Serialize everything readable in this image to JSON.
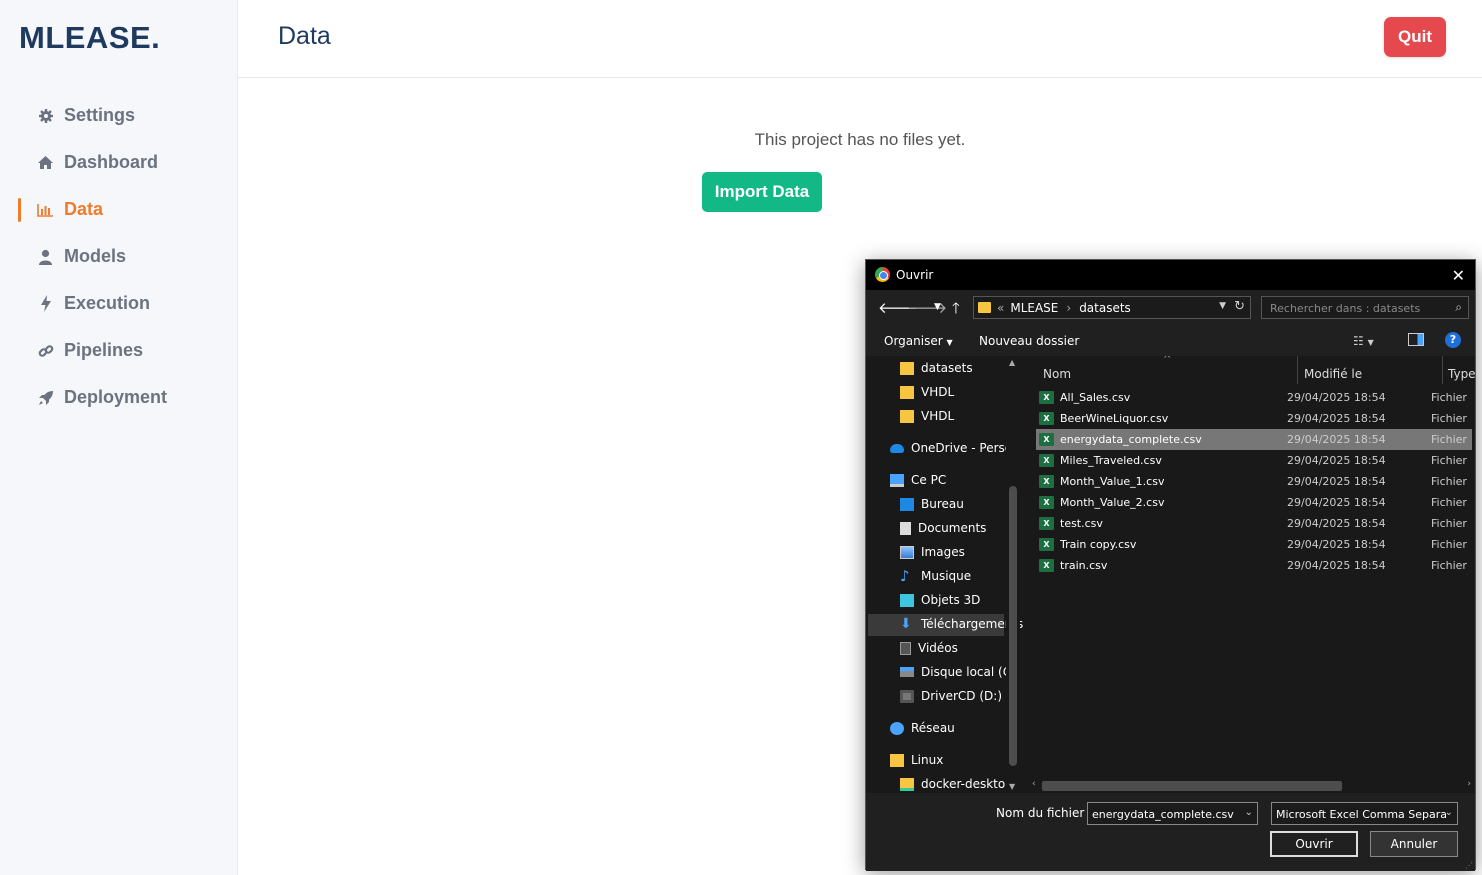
{
  "app": {
    "logo": "MLEASE."
  },
  "sidebar": {
    "items": [
      {
        "label": "Settings",
        "icon": "gear-icon"
      },
      {
        "label": "Dashboard",
        "icon": "home-icon"
      },
      {
        "label": "Data",
        "icon": "bar-chart-icon",
        "active": true
      },
      {
        "label": "Models",
        "icon": "user-icon"
      },
      {
        "label": "Execution",
        "icon": "bolt-icon"
      },
      {
        "label": "Pipelines",
        "icon": "link-icon"
      },
      {
        "label": "Deployment",
        "icon": "rocket-icon"
      }
    ]
  },
  "header": {
    "title": "Data",
    "quit_label": "Quit"
  },
  "main": {
    "empty_text": "This project has no files yet.",
    "import_label": "Import Data"
  },
  "dialog": {
    "title": "Ouvrir",
    "path": {
      "prefix": "«",
      "segments": [
        "MLEASE",
        "datasets"
      ]
    },
    "search_placeholder": "Rechercher dans : datasets",
    "toolbar": {
      "organize": "Organiser",
      "new_folder": "Nouveau dossier",
      "help": "?"
    },
    "tree": [
      {
        "label": "datasets",
        "icon": "folder-icon"
      },
      {
        "label": "VHDL",
        "icon": "folder-icon"
      },
      {
        "label": "VHDL",
        "icon": "folder-icon"
      },
      {
        "label": "OneDrive - Persor",
        "icon": "cloud-icon"
      },
      {
        "label": "Ce PC",
        "icon": "computer-icon"
      },
      {
        "label": "Bureau",
        "icon": "desktop-icon"
      },
      {
        "label": "Documents",
        "icon": "document-icon"
      },
      {
        "label": "Images",
        "icon": "image-icon"
      },
      {
        "label": "Musique",
        "icon": "music-icon"
      },
      {
        "label": "Objets 3D",
        "icon": "cube-icon"
      },
      {
        "label": "Téléchargements",
        "icon": "download-icon"
      },
      {
        "label": "Vidéos",
        "icon": "video-icon"
      },
      {
        "label": "Disque local (C:)",
        "icon": "drive-icon"
      },
      {
        "label": "DriverCD (D:)",
        "icon": "cd-icon"
      },
      {
        "label": "Réseau",
        "icon": "network-icon"
      },
      {
        "label": "Linux",
        "icon": "folder-icon"
      },
      {
        "label": "docker-desktop",
        "icon": "folder-icon"
      }
    ],
    "columns": {
      "name": "Nom",
      "modified": "Modifié le",
      "type": "Type"
    },
    "files": [
      {
        "name": "All_Sales.csv",
        "modified": "29/04/2025 18:54",
        "type": "Fichier"
      },
      {
        "name": "BeerWineLiquor.csv",
        "modified": "29/04/2025 18:54",
        "type": "Fichier"
      },
      {
        "name": "energydata_complete.csv",
        "modified": "29/04/2025 18:54",
        "type": "Fichier",
        "selected": true
      },
      {
        "name": "Miles_Traveled.csv",
        "modified": "29/04/2025 18:54",
        "type": "Fichier"
      },
      {
        "name": "Month_Value_1.csv",
        "modified": "29/04/2025 18:54",
        "type": "Fichier"
      },
      {
        "name": "Month_Value_2.csv",
        "modified": "29/04/2025 18:54",
        "type": "Fichier"
      },
      {
        "name": "test.csv",
        "modified": "29/04/2025 18:54",
        "type": "Fichier"
      },
      {
        "name": "Train copy.csv",
        "modified": "29/04/2025 18:54",
        "type": "Fichier"
      },
      {
        "name": "train.csv",
        "modified": "29/04/2025 18:54",
        "type": "Fichier"
      }
    ],
    "footer": {
      "filename_label": "Nom du fichier :",
      "filename_value": "energydata_complete.csv",
      "filetype_value": "Microsoft Excel Comma Separa",
      "open_label": "Ouvrir",
      "cancel_label": "Annuler"
    }
  },
  "colors": {
    "brand": "#1e3a5f",
    "active": "#f07b2b",
    "quit": "#e5484d",
    "import": "#12b886"
  }
}
